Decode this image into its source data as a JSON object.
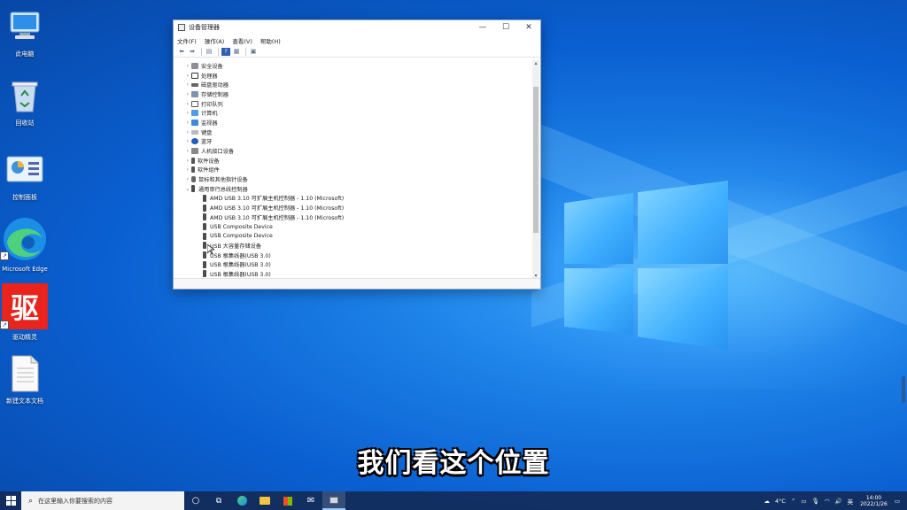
{
  "desktop": {
    "icons": [
      {
        "label": "此电脑",
        "icon": "computer-icon"
      },
      {
        "label": "回收站",
        "icon": "recycle-bin-icon"
      },
      {
        "label": "控制面板",
        "icon": "control-panel-icon"
      },
      {
        "label": "Microsoft Edge",
        "icon": "edge-icon"
      },
      {
        "label": "驱动精灵",
        "icon": "driver-genius-icon",
        "glyph": "驱"
      },
      {
        "label": "新建文本文档",
        "icon": "text-document-icon"
      }
    ]
  },
  "window": {
    "title": "设备管理器",
    "controls": {
      "minimize": "—",
      "maximize": "☐",
      "close": "✕"
    },
    "menu": [
      "文件(F)",
      "操作(A)",
      "查看(V)",
      "帮助(H)"
    ],
    "categories": [
      {
        "label": "安全设备",
        "expanded": false
      },
      {
        "label": "处理器",
        "expanded": false
      },
      {
        "label": "磁盘驱动器",
        "expanded": false
      },
      {
        "label": "存储控制器",
        "expanded": false
      },
      {
        "label": "打印队列",
        "expanded": false
      },
      {
        "label": "计算机",
        "expanded": false
      },
      {
        "label": "监视器",
        "expanded": false
      },
      {
        "label": "键盘",
        "expanded": false
      },
      {
        "label": "蓝牙",
        "expanded": false
      },
      {
        "label": "人机接口设备",
        "expanded": false
      },
      {
        "label": "软件设备",
        "expanded": false
      },
      {
        "label": "软件组件",
        "expanded": false
      },
      {
        "label": "鼠标和其他指针设备",
        "expanded": false
      },
      {
        "label": "通用串行总线控制器",
        "expanded": true
      }
    ],
    "usb_children": [
      "AMD USB 3.10 可扩展主机控制器 - 1.10 (Microsoft)",
      "AMD USB 3.10 可扩展主机控制器 - 1.10 (Microsoft)",
      "AMD USB 3.10 可扩展主机控制器 - 1.10 (Microsoft)",
      "USB Composite Device",
      "USB Composite Device",
      "USB 大容量存储设备",
      "USB 根集线器(USB 3.0)",
      "USB 根集线器(USB 3.0)",
      "USB 根集线器(USB 3.0)"
    ]
  },
  "subtitle": "我们看这个位置",
  "taskbar": {
    "search_placeholder": "在这里输入你要搜索的内容",
    "weather": "4°C",
    "tray_lang": "英",
    "time": "14:00",
    "date": "2022/1/26"
  }
}
